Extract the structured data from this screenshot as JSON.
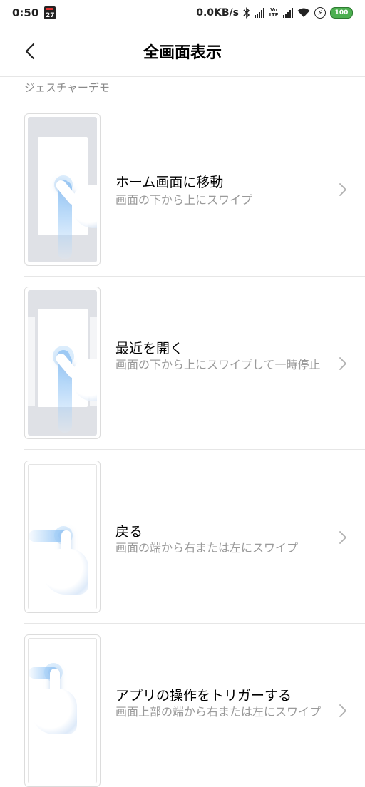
{
  "status_bar": {
    "time": "0:50",
    "calendar_day": "27",
    "net_speed": "0.0KB/s",
    "volte": "Vo LTE",
    "battery": "100"
  },
  "header": {
    "title": "全画面表示"
  },
  "section": {
    "label": "ジェスチャーデモ"
  },
  "items": [
    {
      "title": "ホーム画面に移動",
      "subtitle": "画面の下から上にスワイプ"
    },
    {
      "title": "最近を開く",
      "subtitle": "画面の下から上にスワイプして一時停止"
    },
    {
      "title": "戻る",
      "subtitle": "画面の端から右または左にスワイプ"
    },
    {
      "title": "アプリの操作をトリガーする",
      "subtitle": "画面上部の端から右または左にスワイプ"
    }
  ],
  "icons": {
    "back": "chevron-left-icon",
    "item_arrow": "chevron-right-icon"
  },
  "colors": {
    "accent_blue": "#8fc3f5",
    "battery_green": "#4caf50"
  }
}
